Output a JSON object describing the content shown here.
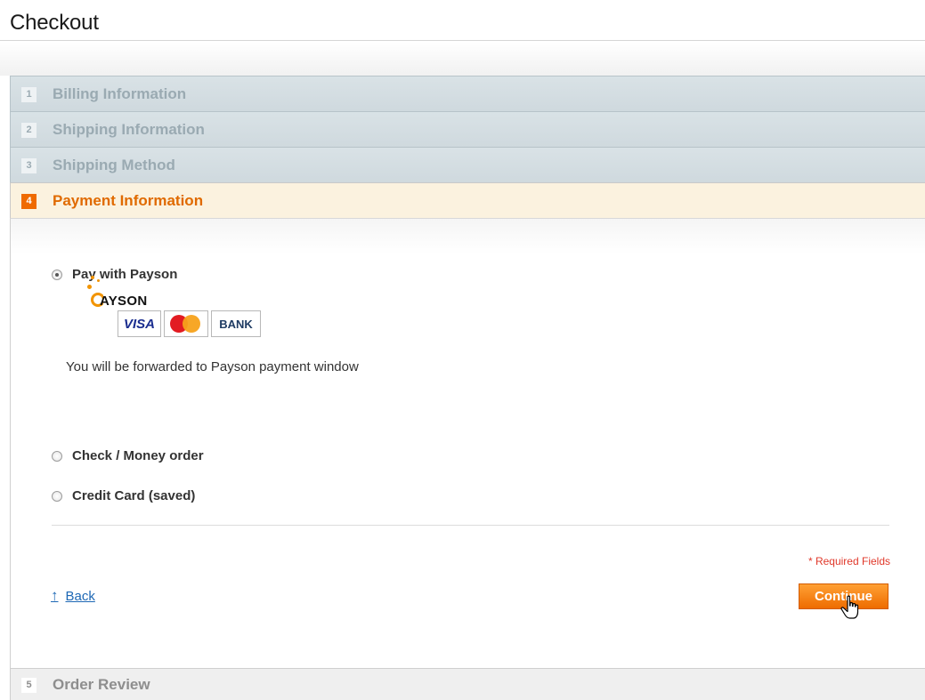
{
  "page": {
    "title": "Checkout"
  },
  "steps": [
    {
      "number": "1",
      "label": "Billing Information"
    },
    {
      "number": "2",
      "label": "Shipping Information"
    },
    {
      "number": "3",
      "label": "Shipping Method"
    },
    {
      "number": "4",
      "label": "Payment Information"
    },
    {
      "number": "5",
      "label": "Order Review"
    }
  ],
  "payment": {
    "methods": [
      {
        "label": "Pay with Payson",
        "selected": true
      },
      {
        "label": "Check / Money order",
        "selected": false
      },
      {
        "label": "Credit Card (saved)",
        "selected": false
      }
    ],
    "payson_logo_text": "AYSON",
    "cards": {
      "visa": "VISA",
      "bank": "BANK"
    },
    "forward_note": "You will be forwarded to Payson payment window",
    "required_note": "* Required Fields",
    "back_label": "Back",
    "continue_label": "Continue"
  },
  "colors": {
    "accent": "#ef6a00",
    "active_label": "#e06a00",
    "link": "#1e68b5",
    "required": "#e0382a"
  },
  "icons": [
    "back-arrow-icon",
    "hand-cursor-icon",
    "radio-icon"
  ]
}
